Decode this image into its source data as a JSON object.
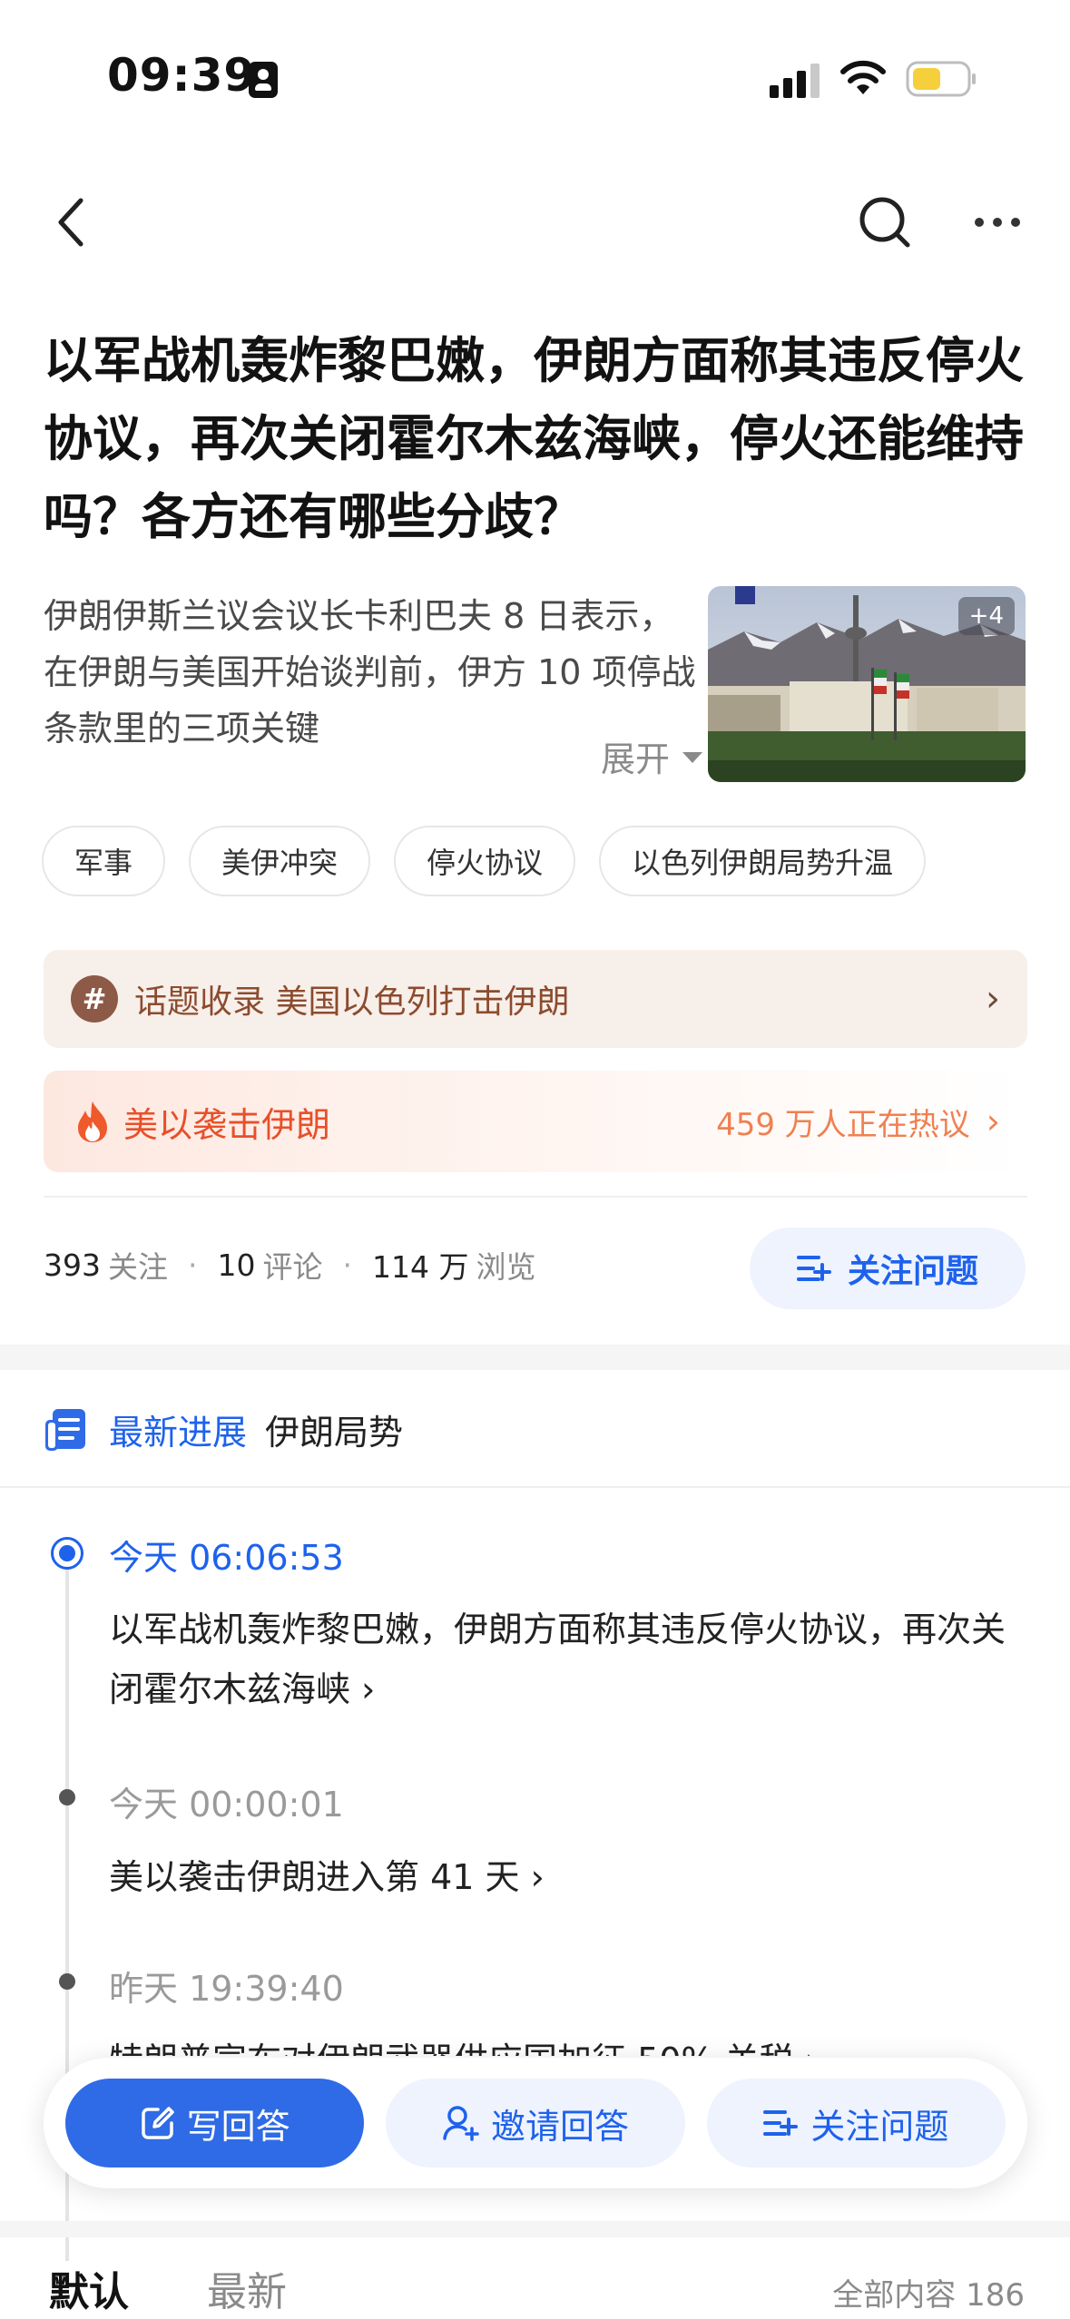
{
  "status_bar": {
    "time": "09:39"
  },
  "nav": {
    "back_icon": "chevron-left-icon",
    "search_icon": "search-icon",
    "more_icon": "more-icon"
  },
  "question": {
    "title": "以军战机轰炸黎巴嫩，伊朗方面称其违反停火协议，再次关闭霍尔木兹海峡，停火还能维持吗？各方还有哪些分歧？",
    "excerpt": "伊朗伊斯兰议会议长卡利巴夫 8 日表示， 在伊朗与美国开始谈判前，伊方 10 项停战条款里的三项关键",
    "expand_label": "展开",
    "image_count": "+4"
  },
  "tags": [
    "军事",
    "美伊冲突",
    "停火协议",
    "以色列伊朗局势升温"
  ],
  "topic": {
    "text": "话题收录 美国以色列打击伊朗",
    "icon": "#"
  },
  "hot": {
    "title": "美以袭击伊朗",
    "count": "459 万人正在热议"
  },
  "stats": {
    "followers_num": "393",
    "followers_label": "关注",
    "comments_num": "10",
    "comments_label": "评论",
    "views_num": "114 万",
    "views_label": "浏览",
    "follow_button": "关注问题"
  },
  "progress": {
    "label": "最新进展",
    "topic": "伊朗局势",
    "items": [
      {
        "time": "今天 06:06:53",
        "text": "以军战机轰炸黎巴嫩，伊朗方面称其违反停火协议，再次关闭霍尔木兹海峡 ›"
      },
      {
        "time": "今天 00:00:01",
        "text": "美以袭击伊朗进入第 41 天 ›"
      },
      {
        "time": "昨天 19:39:40",
        "text": "特朗普宣布对伊朗武器供应国加征 50% 关税 ›"
      }
    ]
  },
  "actions": {
    "write_answer": "写回答",
    "invite_answer": "邀请回答",
    "follow_question": "关注问题"
  },
  "sort": {
    "tabs": [
      "默认",
      "最新"
    ],
    "total": "全部内容 186"
  },
  "colors": {
    "accent": "#1e62ec",
    "hot": "#e8502a",
    "topic": "#8c4b2e"
  }
}
